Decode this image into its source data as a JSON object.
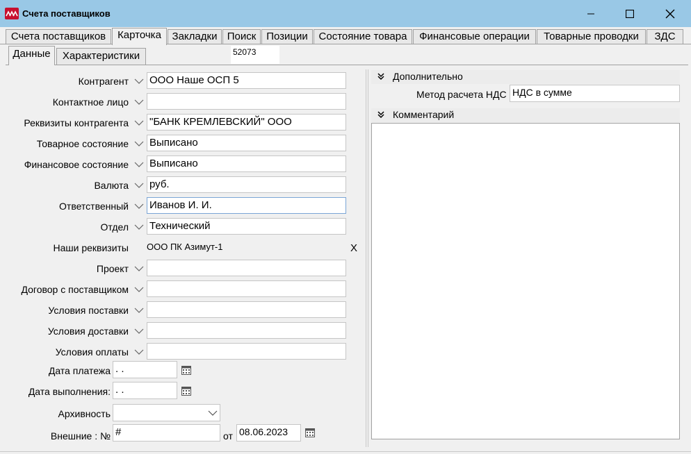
{
  "window": {
    "title": "Счета поставщиков"
  },
  "tabs": [
    {
      "label": "Счета поставщиков"
    },
    {
      "label": "Карточка"
    },
    {
      "label": "Закладки"
    },
    {
      "label": "Поиск"
    },
    {
      "label": "Позиции"
    },
    {
      "label": "Состояние товара"
    },
    {
      "label": "Финансовые операции"
    },
    {
      "label": "Товарные проводки"
    },
    {
      "label": "ЗДС"
    }
  ],
  "subtabs": [
    {
      "label": "Данные"
    },
    {
      "label": "Характеристики"
    }
  ],
  "record_code": "52073",
  "form": {
    "kontragent": {
      "label": "Контрагент",
      "value": "ООО Наше ОСП 5"
    },
    "contact": {
      "label": "Контактное лицо",
      "value": ""
    },
    "requisites": {
      "label": "Реквизиты контрагента",
      "value": "\"БАНК КРЕМЛЕВСКИЙ\" ООО"
    },
    "goods_state": {
      "label": "Товарное состояние",
      "value": "Выписано"
    },
    "fin_state": {
      "label": "Финансовое состояние",
      "value": "Выписано"
    },
    "currency": {
      "label": "Валюта",
      "value": "руб."
    },
    "responsible": {
      "label": "Ответственный",
      "value": "Иванов И. И."
    },
    "department": {
      "label": "Отдел",
      "value": "Технический"
    },
    "our_requisites": {
      "label": "Наши реквизиты",
      "value": "ООО ПК Азимут-1",
      "clear": "X"
    },
    "project": {
      "label": "Проект",
      "value": ""
    },
    "contract": {
      "label": "Договор с поставщиком",
      "value": ""
    },
    "supply_terms": {
      "label": "Условия поставки",
      "value": ""
    },
    "delivery_terms": {
      "label": "Условия доставки",
      "value": ""
    },
    "payment_terms": {
      "label": "Условия оплаты",
      "value": ""
    },
    "pay_date": {
      "label": "Дата платежа",
      "value": " .  ."
    },
    "done_date": {
      "label": "Дата выполнения:",
      "value": " .  ."
    },
    "archive": {
      "label": "Архивность",
      "value": ""
    },
    "external": {
      "label": "Внешние : №",
      "number": "#",
      "from_label": "от",
      "date": "08.06.2023"
    }
  },
  "right": {
    "additional_header": "Дополнительно",
    "vat_label": "Метод расчета НДС",
    "vat_value": "НДС в сумме",
    "comment_header": "Комментарий",
    "comment_value": ""
  },
  "icons": {
    "app": "app-logo-icon",
    "minimize": "minimize-icon",
    "maximize": "maximize-icon",
    "close": "close-icon",
    "dropdown": "chevron-down-icon",
    "calendar": "calendar-icon",
    "collapse": "double-chevron-icon"
  }
}
